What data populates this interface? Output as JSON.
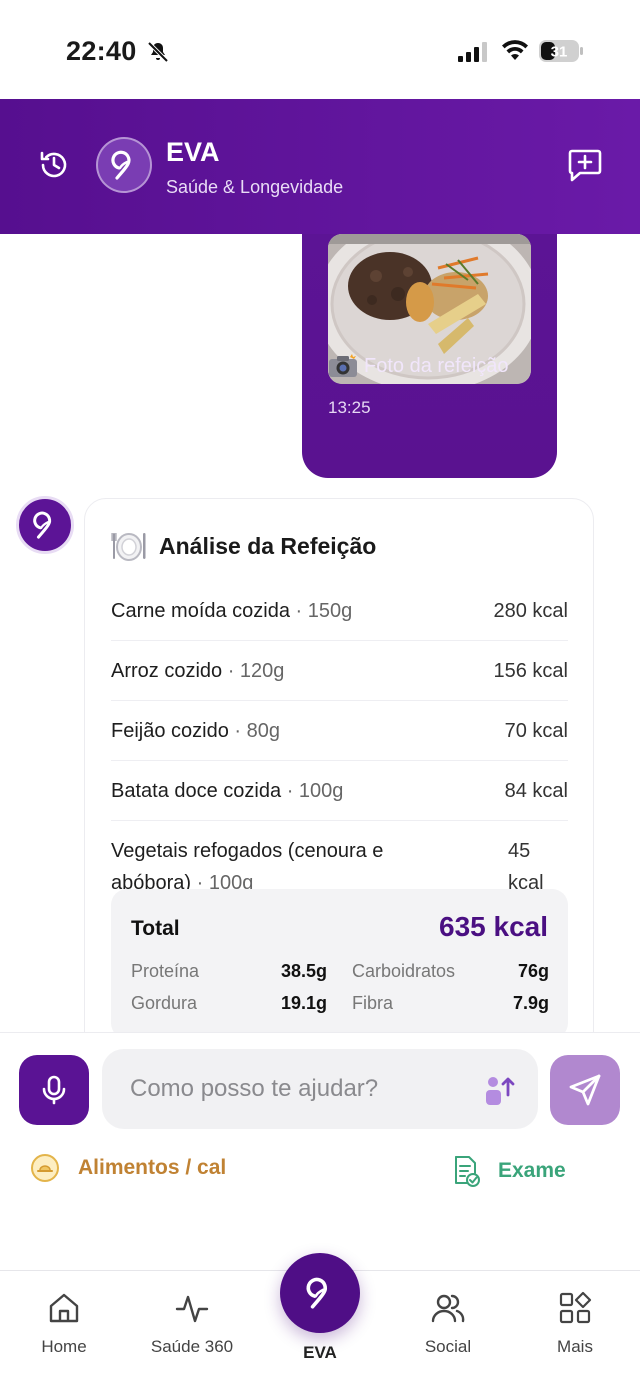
{
  "status_bar": {
    "time": "22:40",
    "battery": "31"
  },
  "header": {
    "title": "EVA",
    "subtitle": "Saúde & Longevidade"
  },
  "user_message": {
    "caption": "Foto da refeição",
    "time": "13:25"
  },
  "analysis": {
    "title": "Análise da Refeição",
    "items": [
      {
        "name": "Carne moída cozida",
        "portion": "· 150g",
        "kcal": "280 kcal"
      },
      {
        "name": "Arroz cozido",
        "portion": "· 120g",
        "kcal": "156 kcal"
      },
      {
        "name": "Feijão cozido",
        "portion": "· 80g",
        "kcal": "70 kcal"
      },
      {
        "name": "Batata doce cozida",
        "portion": "· 100g",
        "kcal": "84 kcal"
      },
      {
        "name": "Vegetais refogados (cenoura e abóbora)",
        "portion": "· 100g",
        "kcal": "45 kcal"
      }
    ],
    "total_label": "Total",
    "total_value": "635 kcal",
    "macros": {
      "protein_label": "Proteína",
      "protein_value": "38.5g",
      "carbs_label": "Carboidratos",
      "carbs_value": "76g",
      "fat_label": "Gordura",
      "fat_value": "19.1g",
      "fiber_label": "Fibra",
      "fiber_value": "7.9g"
    }
  },
  "input": {
    "placeholder": "Como posso te ajudar?"
  },
  "quick_actions": {
    "food": "Alimentos / cal",
    "exam": "Exame"
  },
  "nav": {
    "home": "Home",
    "health": "Saúde 360",
    "eva": "EVA",
    "social": "Social",
    "more": "Mais"
  },
  "colors": {
    "primary": "#5a1394",
    "send_disabled": "#b188cf",
    "food_accent": "#c08233",
    "exam_accent": "#3aa47a",
    "total_accent": "#4a0f82"
  }
}
